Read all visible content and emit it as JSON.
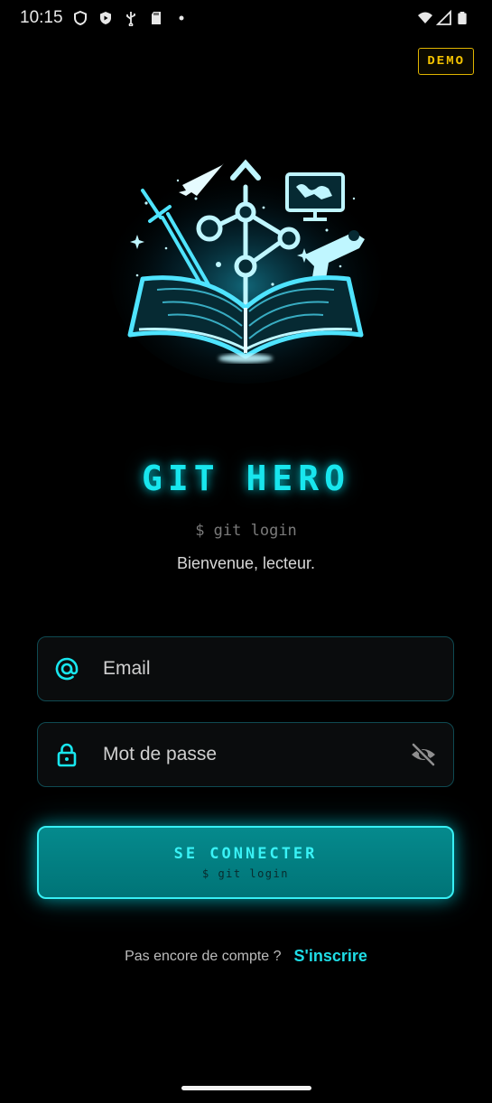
{
  "status_bar": {
    "time": "10:15",
    "icons": [
      "vpn-shield-icon",
      "shield-play-icon",
      "usb-icon",
      "sd-card-icon",
      "dot-icon",
      "wifi-icon",
      "cellular-signal-icon",
      "battery-icon"
    ]
  },
  "demo_badge": "DEMO",
  "logo": {
    "name": "git-hero-logo"
  },
  "title": "GIT HERO",
  "subtitle": "$ git login",
  "welcome": "Bienvenue, lecteur.",
  "email_field": {
    "placeholder": "Email",
    "value": "",
    "icon": "at-sign-icon"
  },
  "password_field": {
    "placeholder": "Mot de passe",
    "value": "",
    "icon": "lock-icon",
    "toggle_icon": "eye-off-icon"
  },
  "login_button": {
    "label": "SE CONNECTER",
    "sublabel": "$ git login"
  },
  "signup": {
    "prompt": "Pas encore de compte ?",
    "link": "S'inscrire"
  },
  "colors": {
    "accent": "#18e6ee",
    "button_bg": "#007a7d",
    "demo": "#f5c400",
    "background": "#000000"
  }
}
